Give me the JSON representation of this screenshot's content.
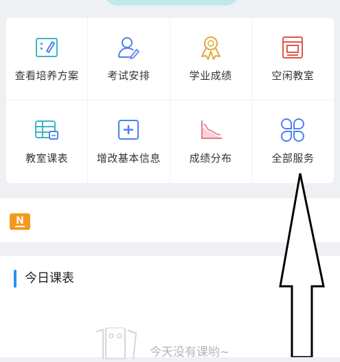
{
  "services": [
    {
      "label": "查看培养方案",
      "icon": "training-plan-icon"
    },
    {
      "label": "考试安排",
      "icon": "exam-schedule-icon"
    },
    {
      "label": "学业成绩",
      "icon": "grades-ribbon-icon"
    },
    {
      "label": "空闲教室",
      "icon": "free-classroom-icon"
    },
    {
      "label": "教室课表",
      "icon": "classroom-timetable-icon"
    },
    {
      "label": "增改基本信息",
      "icon": "edit-info-icon"
    },
    {
      "label": "成绩分布",
      "icon": "grade-distribution-icon"
    },
    {
      "label": "全部服务",
      "icon": "all-services-icon"
    }
  ],
  "notice": {
    "badge": "N"
  },
  "schedule": {
    "title": "今日课表",
    "empty_text": "今天没有课哟~"
  },
  "colors": {
    "accent_blue": "#2a8ff7",
    "notice_orange": "#f39a1e",
    "icon_teal": "#3cb6c7",
    "icon_blue": "#4a7ff0",
    "icon_gold": "#e2a935",
    "icon_red": "#e0564f",
    "icon_pink": "#e87a8e"
  }
}
